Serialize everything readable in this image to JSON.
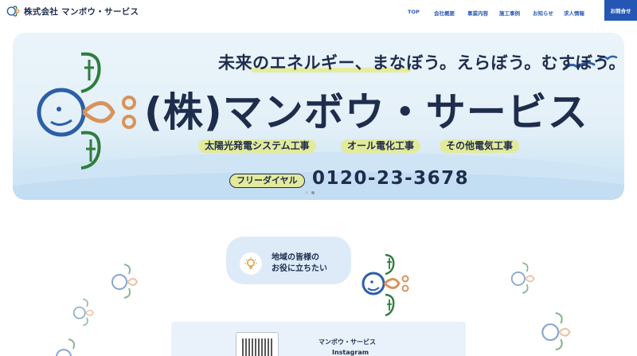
{
  "header": {
    "site_name": "株式会社 マンボウ・サービス",
    "nav": [
      {
        "id": "top",
        "label": "TOP"
      },
      {
        "id": "company",
        "label": "会社概要"
      },
      {
        "id": "business",
        "label": "事業内容"
      },
      {
        "id": "works",
        "label": "施工事例"
      },
      {
        "id": "news",
        "label": "お知らせ"
      },
      {
        "id": "recruit",
        "label": "求人情報"
      }
    ],
    "contact_label": "お問合せ"
  },
  "hero": {
    "tagline": "未来のエネルギー、まなぼう。えらぼう。むすぼう。",
    "company_title": "(株)マンボウ・サービス",
    "services": [
      "太陽光発電システム工事",
      "オール電化工事",
      "その他電気工事"
    ],
    "freedial_label": "フリーダイヤル",
    "phone": "0120-23-3678",
    "slide_count": 2,
    "active_slide": 1
  },
  "intro": {
    "bubble_line1": "地域の皆様の",
    "bubble_line2": "お役に立ちたい"
  },
  "instagram": {
    "name": "マンボウ・サービス",
    "label": "Instagram"
  },
  "colors": {
    "navy": "#1f2d4d",
    "nav_blue": "#2a58b5",
    "contact_bg": "#2457b3",
    "tag_yellow": "#e3ea9b",
    "mascot_green": "#2e7d3c",
    "mascot_blue": "#2c5fa8",
    "mascot_orange": "#d8935b"
  }
}
